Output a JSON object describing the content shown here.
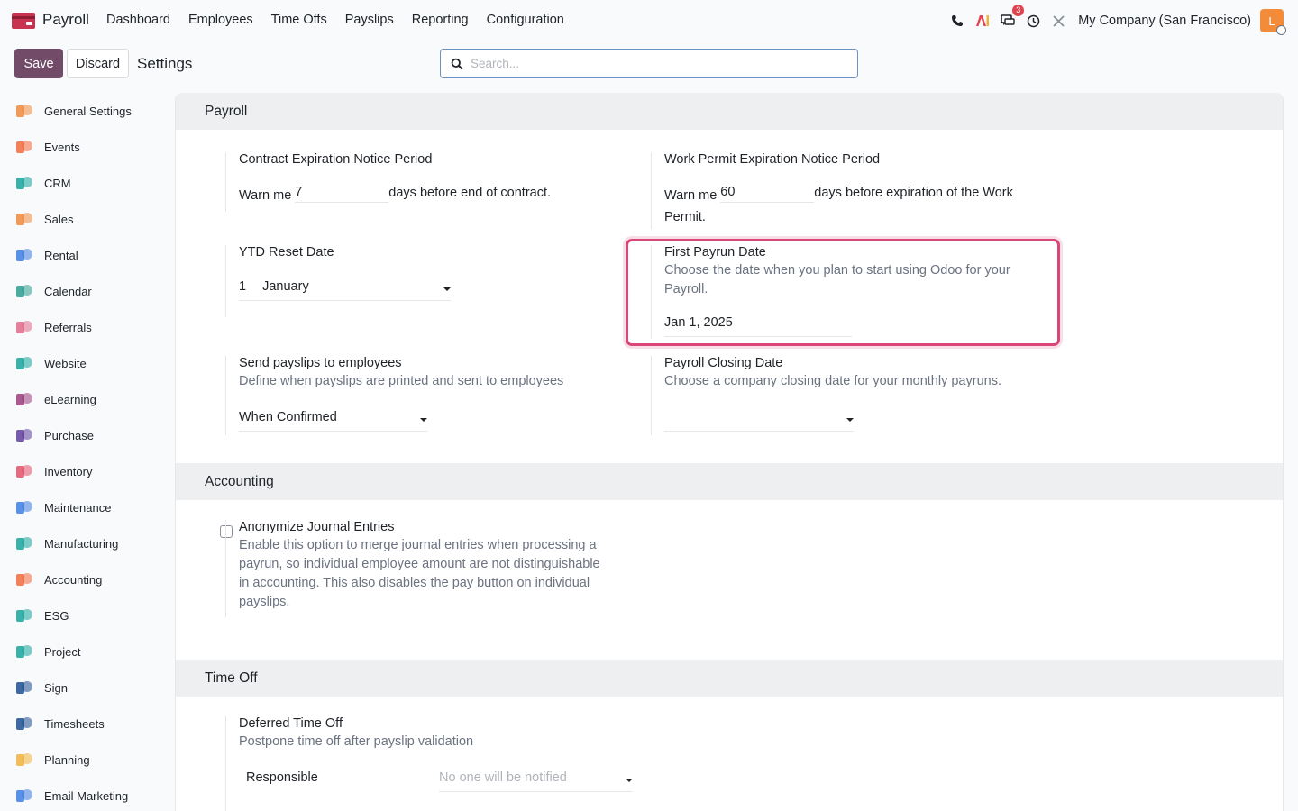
{
  "navbar": {
    "app_name": "Payroll",
    "menu": [
      "Dashboard",
      "Employees",
      "Time Offs",
      "Payslips",
      "Reporting",
      "Configuration"
    ],
    "messages_badge": "3",
    "company": "My Company (San Francisco)",
    "avatar_letter": "L"
  },
  "control": {
    "save": "Save",
    "discard": "Discard",
    "title": "Settings",
    "search_placeholder": "Search..."
  },
  "sidebar": [
    {
      "label": "General Settings",
      "icon": "general-settings-icon",
      "color": "#f08a3e"
    },
    {
      "label": "Events",
      "icon": "events-icon",
      "color": "#f06a3e"
    },
    {
      "label": "CRM",
      "icon": "crm-icon",
      "color": "#1aa39a"
    },
    {
      "label": "Sales",
      "icon": "sales-icon",
      "color": "#f08a3e"
    },
    {
      "label": "Rental",
      "icon": "rental-icon",
      "color": "#3e7ce0"
    },
    {
      "label": "Calendar",
      "icon": "calendar-icon",
      "color": "#2c9c8f"
    },
    {
      "label": "Referrals",
      "icon": "referrals-icon",
      "color": "#e06a8a"
    },
    {
      "label": "Website",
      "icon": "website-icon",
      "color": "#1aa39a"
    },
    {
      "label": "eLearning",
      "icon": "elearning-icon",
      "color": "#9b3e7d"
    },
    {
      "label": "Purchase",
      "icon": "purchase-icon",
      "color": "#5e3e9b"
    },
    {
      "label": "Inventory",
      "icon": "inventory-icon",
      "color": "#e0516a"
    },
    {
      "label": "Maintenance",
      "icon": "maintenance-icon",
      "color": "#3e7ce0"
    },
    {
      "label": "Manufacturing",
      "icon": "manufacturing-icon",
      "color": "#1aa39a"
    },
    {
      "label": "Accounting",
      "icon": "accounting-icon",
      "color": "#f06a3e"
    },
    {
      "label": "ESG",
      "icon": "esg-icon",
      "color": "#1aa39a"
    },
    {
      "label": "Project",
      "icon": "project-icon",
      "color": "#1aa39a"
    },
    {
      "label": "Sign",
      "icon": "sign-icon",
      "color": "#1c4f8f"
    },
    {
      "label": "Timesheets",
      "icon": "timesheets-icon",
      "color": "#1c4f8f"
    },
    {
      "label": "Planning",
      "icon": "planning-icon",
      "color": "#f0b23e"
    },
    {
      "label": "Email Marketing",
      "icon": "email-marketing-icon",
      "color": "#3e7ce0"
    }
  ],
  "payroll": {
    "header": "Payroll",
    "contract": {
      "title": "Contract Expiration Notice Period",
      "prefix": "Warn me",
      "value": "7",
      "suffix": "days before end of contract."
    },
    "permit": {
      "title": "Work Permit Expiration Notice Period",
      "prefix": "Warn me",
      "value": "60",
      "suffix": "days before expiration of the Work",
      "suffix2": "Permit."
    },
    "ytd": {
      "title": "YTD Reset Date",
      "day": "1",
      "month": "January"
    },
    "first_payrun": {
      "title": "First Payrun Date",
      "desc": "Choose the date when you plan to start using Odoo for your Payroll.",
      "value": "Jan 1, 2025"
    },
    "send_payslips": {
      "title": "Send payslips to employees",
      "desc": "Define when payslips are printed and sent to employees",
      "value": "When Confirmed"
    },
    "closing": {
      "title": "Payroll Closing Date",
      "desc": "Choose a company closing date for your monthly payruns.",
      "value": ""
    }
  },
  "accounting": {
    "header": "Accounting",
    "anonymize": {
      "title": "Anonymize Journal Entries",
      "desc": "Enable this option to merge journal entries when processing a payrun, so individual employee amount are not distinguishable in accounting. This also disables the pay button on individual payslips."
    }
  },
  "timeoff": {
    "header": "Time Off",
    "deferred": {
      "title": "Deferred Time Off",
      "desc": "Postpone time off after payslip validation",
      "responsible_label": "Responsible",
      "responsible_placeholder": "No one will be notified"
    }
  }
}
